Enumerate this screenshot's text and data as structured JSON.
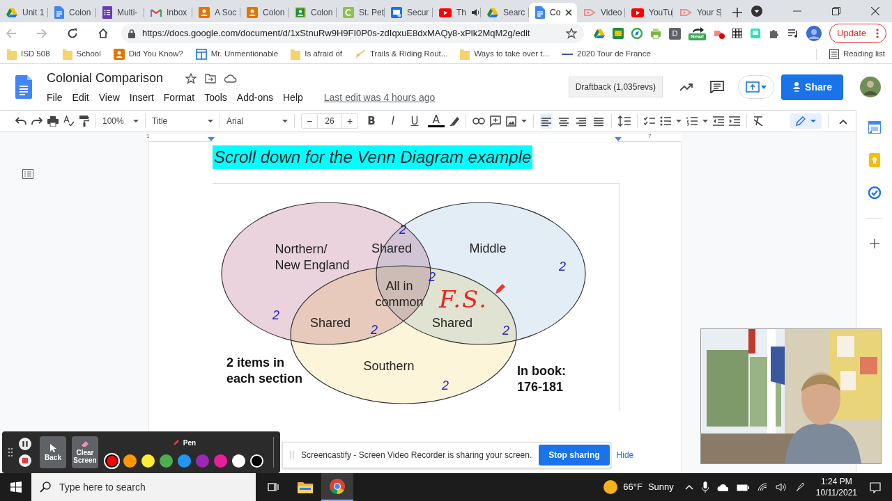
{
  "browser": {
    "tabs": [
      {
        "label": "Unit 1",
        "kind": "drive",
        "audio": false,
        "selected": false
      },
      {
        "label": "Colon",
        "kind": "docs",
        "audio": false,
        "selected": false
      },
      {
        "label": "Multi-",
        "kind": "forms",
        "audio": false,
        "selected": false
      },
      {
        "label": "Inbox",
        "kind": "gmail",
        "audio": false,
        "selected": false
      },
      {
        "label": "A Soc",
        "kind": "classroom",
        "audio": false,
        "selected": false
      },
      {
        "label": "Colon",
        "kind": "classroom",
        "audio": false,
        "selected": false
      },
      {
        "label": "Colon",
        "kind": "classroom-yellow",
        "audio": false,
        "selected": false
      },
      {
        "label": "St. Pet",
        "kind": "sites",
        "audio": false,
        "selected": false
      },
      {
        "label": "Secur",
        "kind": "monitor",
        "audio": false,
        "selected": false
      },
      {
        "label": "Th",
        "kind": "youtube",
        "audio": true,
        "selected": false
      },
      {
        "label": "Searc",
        "kind": "drive",
        "audio": false,
        "selected": false
      },
      {
        "label": "Co",
        "kind": "docs",
        "audio": false,
        "selected": true
      },
      {
        "label": "Video",
        "kind": "screencastify",
        "audio": false,
        "selected": false
      },
      {
        "label": "YouTu",
        "kind": "youtube",
        "audio": false,
        "selected": false
      },
      {
        "label": "Your S",
        "kind": "screencastify",
        "audio": false,
        "selected": false
      }
    ],
    "url": "https://docs.google.com/document/d/1xStnuRw9H9FI0P0s-zdIqxuE8dxMAQy8-xPlk2MqM2g/edit",
    "extension_letter": "D",
    "extension_badge": "New!",
    "update": "Update"
  },
  "bookmarks": {
    "items": [
      {
        "label": "ISD 508",
        "kind": "folder"
      },
      {
        "label": "School",
        "kind": "folder"
      },
      {
        "label": "Did You Know?",
        "kind": "classroom"
      },
      {
        "label": "Mr. Unmentionable",
        "kind": "layout"
      },
      {
        "label": "Is afraid of",
        "kind": "folder"
      },
      {
        "label": "Trails & Riding Rout...",
        "kind": "map"
      },
      {
        "label": "Ways to take over t...",
        "kind": "folder"
      },
      {
        "label": "2020 Tour de France",
        "kind": "line"
      }
    ],
    "reading_list": "Reading list"
  },
  "docs": {
    "title": "Colonial Comparison",
    "menu": [
      "File",
      "Edit",
      "View",
      "Insert",
      "Format",
      "Tools",
      "Add-ons",
      "Help"
    ],
    "last_edit": "Last edit was 4 hours ago",
    "draftback": "Draftback (1,035revs)",
    "share": "Share",
    "toolbar": {
      "zoom": "100%",
      "style": "Title",
      "font": "Arial",
      "size": "26",
      "size_minus": "−",
      "size_plus": "+",
      "format": [
        "B",
        "I",
        "U",
        "A"
      ],
      "align": [
        {
          "kind": "left",
          "selected": true
        },
        {
          "kind": "center",
          "selected": false
        },
        {
          "kind": "right",
          "selected": false
        },
        {
          "kind": "justify",
          "selected": false
        }
      ]
    },
    "ruler": [
      "1",
      "7"
    ],
    "heading": "Scroll down for the Venn Diagram example",
    "venn": {
      "circles": [
        {
          "color": "#ead3dd"
        },
        {
          "color": "#e3edf6"
        },
        {
          "color": "#fcf5d9"
        }
      ],
      "labels": [
        "Northern/\nNew England",
        "Shared",
        "Middle",
        "All in\ncommon",
        "Shared",
        "Shared",
        "Southern"
      ],
      "counts": [
        "2",
        "2",
        "2",
        "2",
        "2",
        "2",
        "2"
      ],
      "notes": [
        "2 items in\neach section",
        "In book:\n176-181"
      ],
      "annotation": "F.S."
    }
  },
  "screencastify": {
    "back": "Back",
    "clear": "Clear\nScreen",
    "pen": "Pen",
    "colors": [
      {
        "color": "#ff0000",
        "selected": true
      },
      {
        "color": "#ff9800",
        "selected": false
      },
      {
        "color": "#ffeb3b",
        "selected": false
      },
      {
        "color": "#4caf50",
        "selected": false
      },
      {
        "color": "#2196f3",
        "selected": false
      },
      {
        "color": "#9c27b0",
        "selected": false
      },
      {
        "color": "#e91e9c",
        "selected": false
      },
      {
        "color": "#ffffff",
        "selected": false
      },
      {
        "color": "#000000",
        "selected": false
      }
    ]
  },
  "sharing": {
    "message": "Screencastify - Screen Video Recorder is sharing your screen.",
    "stop": "Stop sharing",
    "hide": "Hide"
  },
  "taskbar": {
    "search_placeholder": "Type here to search",
    "temperature": "66°F",
    "condition": "Sunny",
    "time": "1:24 PM",
    "date": "10/11/2021"
  }
}
